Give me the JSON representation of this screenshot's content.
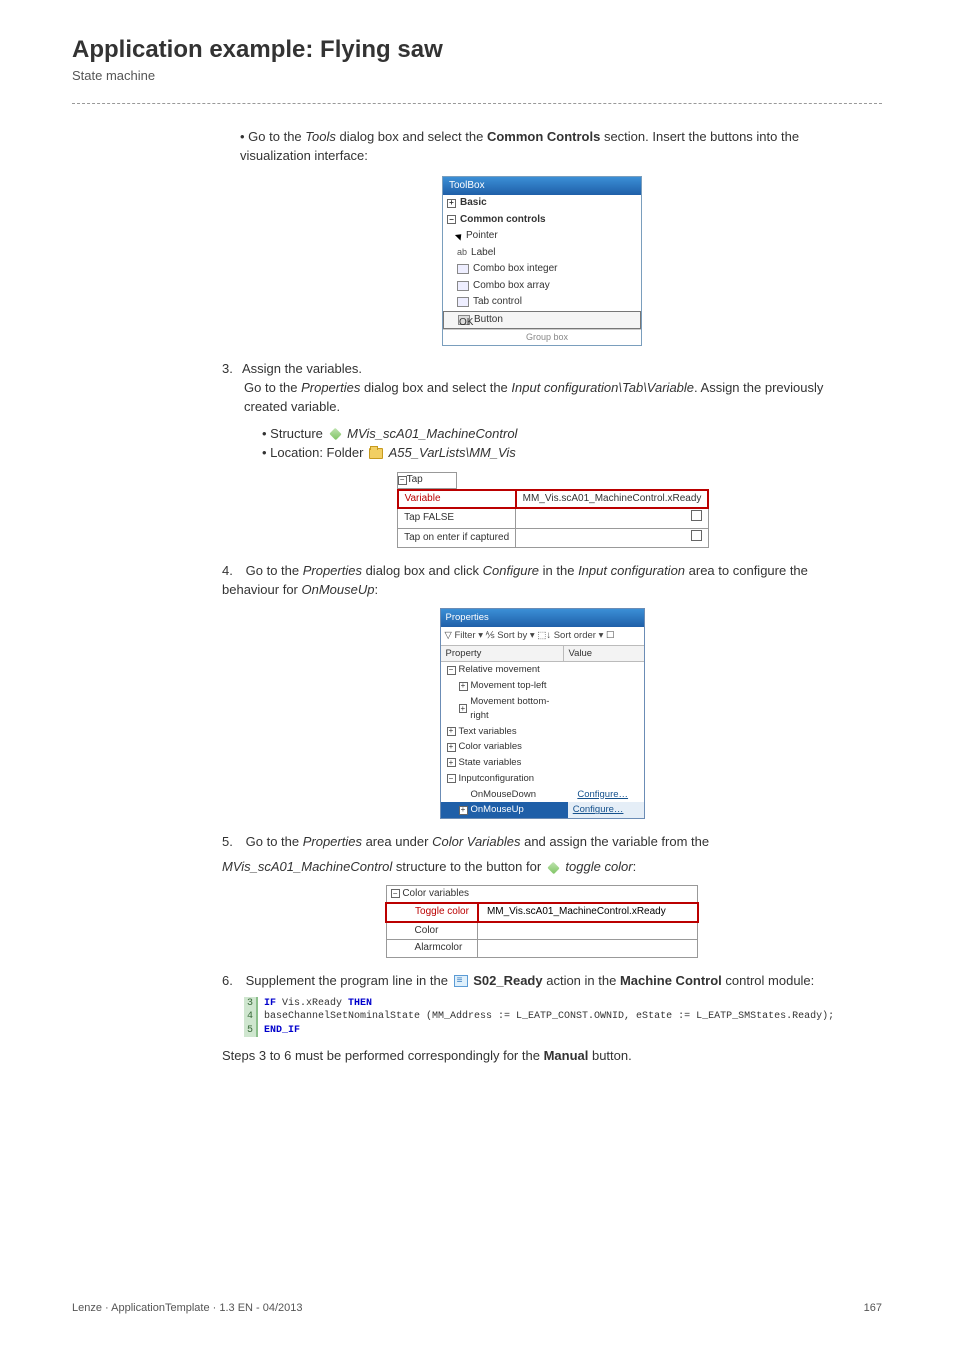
{
  "header": {
    "title": "Application example: Flying saw",
    "subtitle": "State machine"
  },
  "step_bullet_intro": "Go to the Tools dialog box and select the Common Controls section. Insert the buttons into the visualization interface:",
  "toolbox": {
    "title": "ToolBox",
    "group_basic": "Basic",
    "group_common": "Common controls",
    "items": {
      "pointer": "Pointer",
      "label": "Label",
      "combo_int": "Combo box integer",
      "combo_arr": "Combo box array",
      "tab": "Tab control",
      "button": "Button",
      "groupbox": "Group box"
    }
  },
  "step3": {
    "num": "3.",
    "title": "Assign the variables.",
    "para_a": "Go to the ",
    "para_b": "Properties",
    "para_c": " dialog box and select the ",
    "para_d": "Input configuration\\Tab\\Variable",
    "para_e": ". Assign the previously created                   variable.",
    "bul1_a": "Structure ",
    "bul1_b": "MVis_scA01_MachineControl",
    "bul2_a": "Location: Folder ",
    "bul2_b": "A55_VarLists\\MM_Vis"
  },
  "taptable": {
    "tap": "Tap",
    "variable": "Variable",
    "val": "MM_Vis.scA01_MachineControl.xReady",
    "tap_false": "Tap FALSE",
    "tap_enter": "Tap on enter if captured"
  },
  "step4": {
    "num": "4.",
    "a": "Go to the ",
    "b": "Properties",
    "c": " dialog box and click ",
    "d": "Configure",
    "e": " in the ",
    "f": "Input configuration",
    "g": " area to configure the behaviour for ",
    "h": "OnMouseUp",
    "i": ":"
  },
  "props": {
    "title": "Properties",
    "toolbar": "▽ Filter ▾   ⅍ Sort by ▾  ⬚↓ Sort order ▾  ☐",
    "th_prop": "Property",
    "th_val": "Value",
    "rel": "Relative movement",
    "mtl": "Movement top-left",
    "mbr": "Movement bottom-right",
    "tv": "Text variables",
    "cv": "Color variables",
    "sv": "State variables",
    "ic": "Inputconfiguration",
    "omd": "OnMouseDown",
    "omu": "OnMouseUp",
    "conf": "Configure…"
  },
  "step5": {
    "num": "5.",
    "a": "Go to the ",
    "b": "Properties",
    "c": " area under ",
    "d": "Color Variables",
    "e": " and assign the variable from the ",
    "f": "MVis_scA01_MachineControl",
    "g": " structure to the button for ",
    "h": "toggle color",
    "i": ":"
  },
  "colorvars": {
    "head": "Color variables",
    "toggle": "Toggle color",
    "val": "MM_Vis.scA01_MachineControl.xReady",
    "color": "Color",
    "alarm": "Alarmcolor"
  },
  "step6": {
    "num": "6.",
    "a": "Supplement the program line in the ",
    "b": "S02_Ready",
    "c": " action in the ",
    "d": "Machine Control",
    "e": " control module:"
  },
  "code": {
    "n3": "3",
    "n4": "4",
    "n5": "5",
    "l3a": "IF",
    "l3b": " Vis.xReady ",
    "l3c": "THEN",
    "l4": "   baseChannelSetNominalState (MM_Address := L_EATP_CONST.OWNID, eState := L_EATP_SMStates.Ready);",
    "l5": "END_IF"
  },
  "closing_a": "Steps 3 to 6 must be performed correspondingly for the ",
  "closing_b": "Manual",
  "closing_c": " button.",
  "footer": {
    "left": "Lenze · ApplicationTemplate · 1.3 EN - 04/2013",
    "right": "167"
  }
}
